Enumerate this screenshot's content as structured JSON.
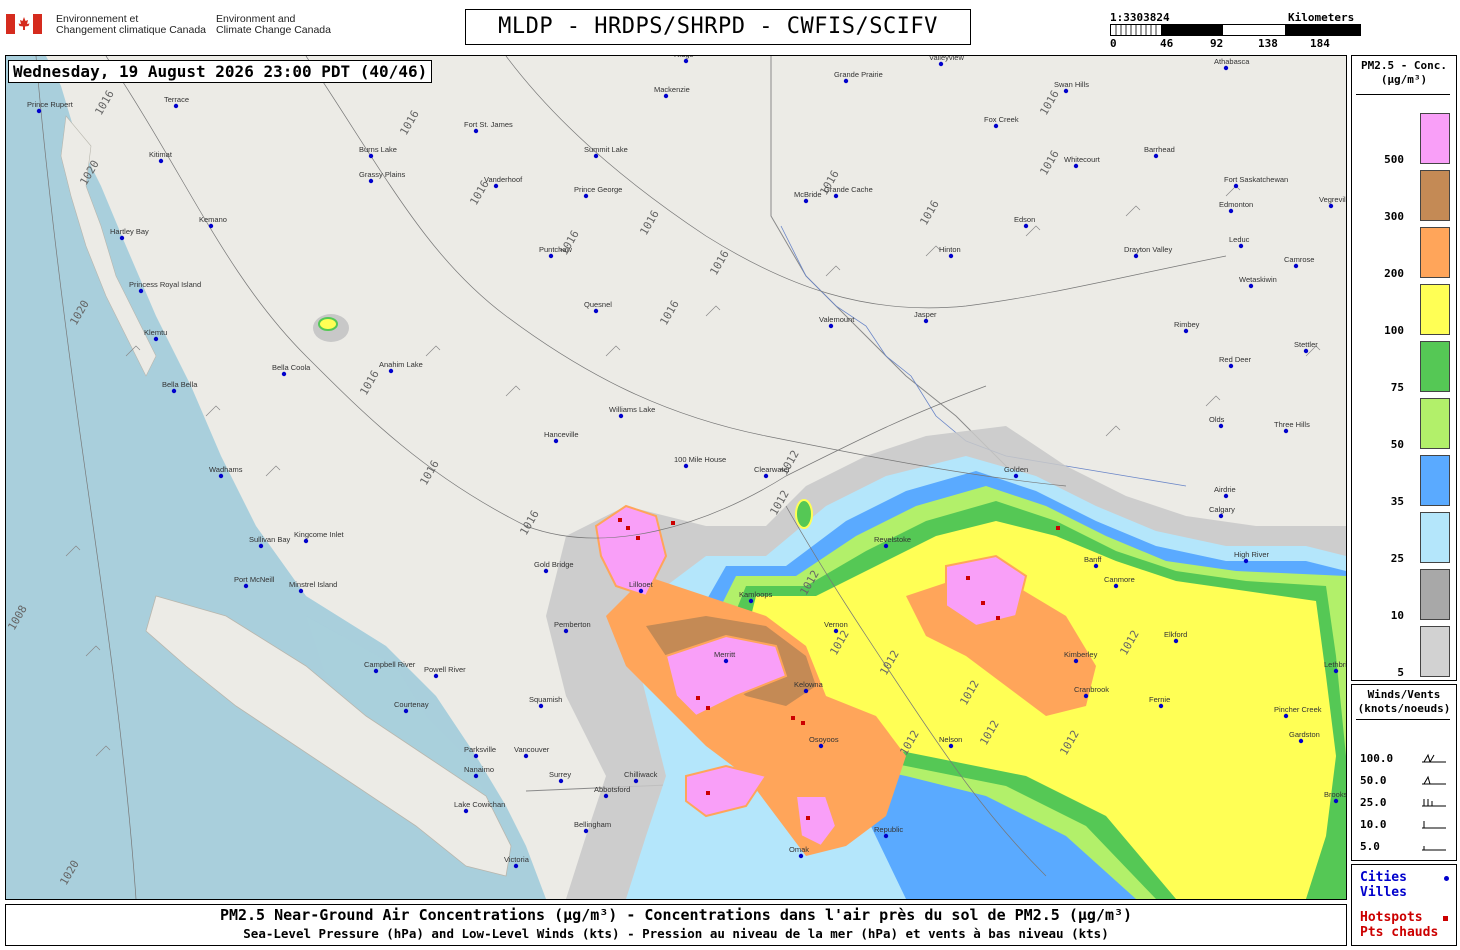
{
  "header": {
    "agency_fr": [
      "Environnement et",
      "Changement climatique Canada"
    ],
    "agency_en": [
      "Environment and",
      "Climate Change Canada"
    ],
    "title": "MLDP - HRDPS/SHRPD - CWFIS/SCIFV",
    "scale_ratio": "1:3303824",
    "scale_unit": "Kilometers",
    "scale_ticks": [
      "0",
      "46",
      "92",
      "138",
      "184"
    ]
  },
  "map": {
    "timestamp": "Wednesday, 19 August 2026 23:00 PDT (40/46)",
    "isobar_labels": [
      "1016",
      "1016",
      "1016",
      "1016",
      "1016",
      "1016",
      "1016",
      "1016",
      "1016",
      "1016",
      "1016",
      "1016",
      "1016",
      "1016",
      "1012",
      "1012",
      "1012",
      "1012",
      "1012",
      "1012",
      "1012",
      "1012",
      "1012",
      "1012",
      "1020",
      "1020",
      "1020",
      "1008"
    ],
    "cities": [
      "Prince Rupert",
      "Terrace",
      "Kitimat",
      "Hartley Bay",
      "Kemano",
      "Princess Royal Island",
      "Klemtu",
      "Bella Bella",
      "Bella Coola",
      "Anahim Lake",
      "Burns Lake",
      "Grassy Plains",
      "Fort St. James",
      "Vanderhoof",
      "Prince George",
      "Summit Lake",
      "Quesnel",
      "Williams Lake",
      "Hanceville",
      "100 Mile House",
      "Puntchaw",
      "Wadhams",
      "Sullivan Bay",
      "Kingcome Inlet",
      "Port McNeill",
      "Minstrel Island",
      "Gold Bridge",
      "Lillooet",
      "Pemberton",
      "Squamish",
      "Vancouver",
      "Surrey",
      "Abbotsford",
      "Chilliwack",
      "Bellingham",
      "Campbell River",
      "Powell River",
      "Courtenay",
      "Port Alberni",
      "Parksville",
      "Nanaimo",
      "Lake Cowichan",
      "Victoria",
      "Merritt",
      "Kamloops",
      "Clearwater",
      "Valemount",
      "McBride",
      "Jasper",
      "Hinton",
      "Edson",
      "Grande Prairie",
      "Valleyview",
      "Fox Creek",
      "Whitecourt",
      "Barrhead",
      "Athabasca",
      "Swan Hills",
      "Fort Saskatchewan",
      "Edmonton",
      "Leduc",
      "Drayton Valley",
      "Wetaskiwin",
      "Camrose",
      "Rimbey",
      "Red Deer",
      "Stettler",
      "Olds",
      "Three Hills",
      "Airdrie",
      "Calgary",
      "High River",
      "Revelstoke",
      "Golden",
      "Vernon",
      "Kelowna",
      "Osoyoos",
      "Nelson",
      "Cranbrook",
      "Kimberley",
      "Fernie",
      "Elkford",
      "Banff",
      "Canmore",
      "Vegreville",
      "Pincher Creek",
      "Lethbridge",
      "Gardston",
      "Brooks",
      "Ridge",
      "Mackenzie",
      "Grande Cache",
      "Omak",
      "Republic"
    ]
  },
  "legend_pm": {
    "title_line1": "PM2.5 - Conc.",
    "title_line2": "(µg/m³)",
    "swatches": [
      {
        "color": "#f99ff8",
        "label": "500"
      },
      {
        "color": "#c48a55",
        "label": "300"
      },
      {
        "color": "#ffa55a",
        "label": "200"
      },
      {
        "color": "#ffff55",
        "label": "100"
      },
      {
        "color": "#55c855",
        "label": "75"
      },
      {
        "color": "#b2f06a",
        "label": "50"
      },
      {
        "color": "#5aaaff",
        "label": "35"
      },
      {
        "color": "#b4e6fb",
        "label": "25"
      },
      {
        "color": "#a8a8a8",
        "label": "10"
      },
      {
        "color": "#d2d2d2",
        "label": "5"
      }
    ]
  },
  "legend_wind": {
    "title_line1": "Winds/Vents",
    "title_line2": "(knots/noeuds)",
    "rows": [
      {
        "label": "100.0"
      },
      {
        "label": "50.0"
      },
      {
        "label": "25.0"
      },
      {
        "label": "10.0"
      },
      {
        "label": "5.0"
      }
    ]
  },
  "legend_points": {
    "cities_line1": "Cities",
    "cities_line2": "Villes",
    "hotspots_line1": "Hotspots",
    "hotspots_line2": "Pts chauds",
    "city_color": "#0000cc",
    "hotspot_color": "#cc0000"
  },
  "footer": {
    "line1": "PM2.5 Near-Ground Air Concentrations (µg/m³) - Concentrations dans l'air près du sol de PM2.5 (µg/m³)",
    "line2": "Sea-Level Pressure (hPa) and Low-Level Winds (kts) - Pression au niveau de la mer (hPa) et vents à bas niveau (kts)"
  }
}
